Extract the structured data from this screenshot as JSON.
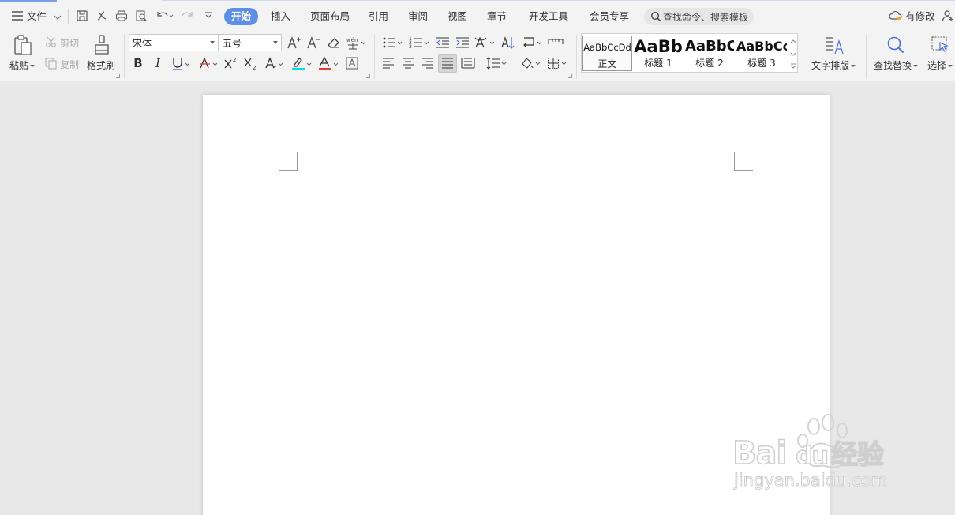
{
  "menu": {
    "file_label": "文件",
    "tabs": [
      {
        "label": "开始",
        "active": true
      },
      {
        "label": "插入"
      },
      {
        "label": "页面布局"
      },
      {
        "label": "引用"
      },
      {
        "label": "审阅"
      },
      {
        "label": "视图"
      },
      {
        "label": "章节"
      },
      {
        "label": "开发工具"
      },
      {
        "label": "会员专享"
      }
    ],
    "search_placeholder": "查找命令、搜索模板",
    "cloud_status": "有修改"
  },
  "ribbon": {
    "paste_label": "粘贴",
    "cut_label": "剪切",
    "copy_label": "复制",
    "format_painter_label": "格式刷",
    "font_name": "宋体",
    "font_size": "五号",
    "styles": [
      {
        "sample": "AaBbCcDd",
        "name": "正文"
      },
      {
        "sample": "AaBb",
        "name": "标题 1"
      },
      {
        "sample": "AaBbC",
        "name": "标题 2"
      },
      {
        "sample": "AaBbCc",
        "name": "标题 3"
      }
    ],
    "text_layout_label": "文字排版",
    "find_replace_label": "查找替换",
    "select_label": "选择"
  },
  "watermark": {
    "brand": "Bai",
    "brand2": "du",
    "suffix": "经验",
    "url": "jingyan.baidu.com"
  },
  "colors": {
    "accent": "#5e8fe6",
    "highlight": "#00e0e0",
    "font_color": "#e03a3a"
  }
}
